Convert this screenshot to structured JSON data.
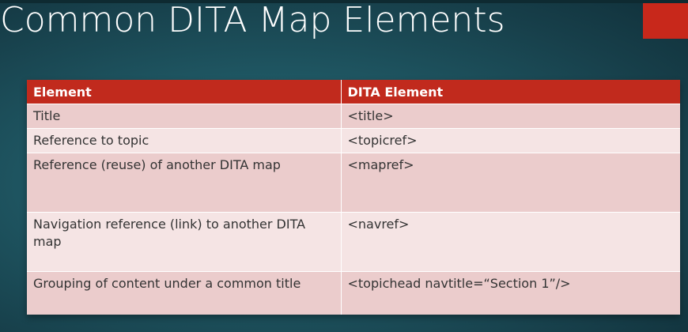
{
  "slide": {
    "title": "Common DITA Map Elements",
    "accent_color": "#c8281b",
    "background_color": "#1f5763"
  },
  "table": {
    "headers": [
      "Element",
      "DITA Element"
    ],
    "rows": [
      [
        "Title",
        "<title>"
      ],
      [
        "Reference to topic",
        "<topicref>"
      ],
      [
        "Reference (reuse) of another DITA map",
        "<mapref>"
      ],
      [
        "Navigation reference (link) to another DITA map",
        "<navref>"
      ],
      [
        "Grouping of content under a common title",
        "<topichead navtitle=“Section 1”/>"
      ]
    ]
  }
}
